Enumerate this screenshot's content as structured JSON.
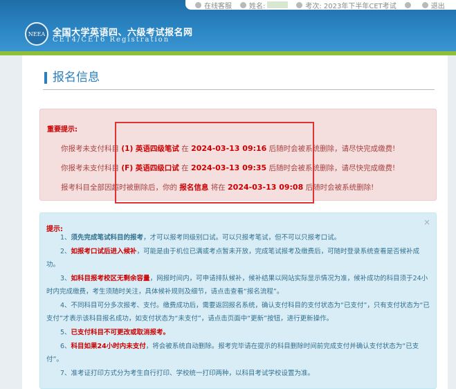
{
  "topbar": {
    "support": "在线客服",
    "name_label": "姓名:",
    "exam_label": "考次: 2023年下半年CET考试",
    "edit_icon": "edit-icon",
    "logout": "退出"
  },
  "header": {
    "logo_text": "NEEA",
    "title": "全国大学英语四、六级考试报名网",
    "subtitle": "CET4/CET6   Registration"
  },
  "section": {
    "title": "报名信息"
  },
  "notice": {
    "heading": "重要提示:",
    "lines": [
      {
        "pre": "你报考未支付科目",
        "subject": "(1) 英语四级笔试",
        "mid": "在",
        "datetime": "2024-03-13 09:16",
        "post": "后随时会被系统删除，请尽快完成缴费!"
      },
      {
        "pre": "你报考未支付科目",
        "subject": "(F) 英语四级口试",
        "mid": "在",
        "datetime": "2024-03-13 09:35",
        "post": "后随时会被系统删除，请尽快完成缴费!"
      },
      {
        "pre": "报考科目全部因超时被删除后，你的",
        "subject": "报名信息",
        "mid": "将在",
        "datetime": "2024-03-13 09:08",
        "post": "后随时会被系统删除!"
      }
    ]
  },
  "tips": {
    "close": "×",
    "heading": "提示:",
    "items": [
      {
        "num": "1、",
        "strong": "须先完成笔试科目的报考",
        "text": "，才可以报考同级别口试。可以只报考笔试，但不可以只报考口试。"
      },
      {
        "num": "2、",
        "strong": "如报考口试后进入候补",
        "text": "，可能是由于机位已满或考点暂未开放，完成笔试报考及缴费后，可随时登录系统查看是否候补成功。"
      },
      {
        "num": "3、",
        "strong": "如科目报考校区无剩余容量",
        "text": "，网报时间内，可申请排队候补，候补结果以网站实际显示情况为准，候补成功的科目须于24小时内完成缴费，考生须随时关注，具体候补规则及细节，请点击查看“报名流程”。"
      },
      {
        "num": "4、",
        "strong": "",
        "text": "不同科目可分多次报考、支付。缴费成功后，需要返回报名系统，确认支付科目的支付状态为“已支付”，只有支付状态为“已支付”才表示该科目报名成功，如支付状态为“未支付”，请点击页面中“更新”按钮，进行更新操作。"
      },
      {
        "num": "5、",
        "strong": "已支付科目不可更改或取消报考。",
        "text": ""
      },
      {
        "num": "6、",
        "strong": "科目如果24小时内未支付",
        "text": "，将会被系统自动删除。报考完毕请在提示的科目删除时间前完成支付并确认支付状态为“已支付”。"
      },
      {
        "num": "7、",
        "strong": "",
        "text": "准考证打印方式分为考生自行打印、学校统一打印两种，以科目考试学校设置为准。"
      }
    ]
  }
}
